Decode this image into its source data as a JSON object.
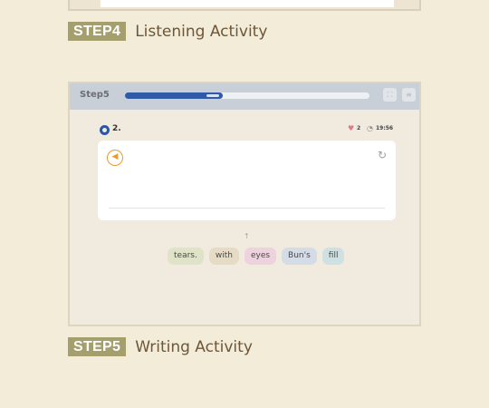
{
  "step4": {
    "badge": "STEP4",
    "title": "Listening Activity"
  },
  "activity": {
    "step_label": "Step5",
    "progress": 0.4,
    "question_number": "2.",
    "lives": "2",
    "timer": "19:56",
    "hint_arrow": "↑",
    "word_chips": [
      {
        "text": "tears.",
        "color": "#dfe3c8"
      },
      {
        "text": "with",
        "color": "#e6dcc6"
      },
      {
        "text": "eyes",
        "color": "#ecd3dd"
      },
      {
        "text": "Bun's",
        "color": "#d4dce6"
      },
      {
        "text": "fill",
        "color": "#cfe0e3"
      }
    ],
    "icons": {
      "question": "question-circle-icon",
      "lives": "heart-icon",
      "timer": "timer-icon",
      "audio": "speaker-icon",
      "refresh": "refresh-icon",
      "header_button_1": "expand-icon",
      "header_button_2": "menu-icon"
    }
  },
  "step5": {
    "badge": "STEP5",
    "title": "Writing Activity"
  },
  "colors": {
    "background": "#f2ecd9",
    "badge": "#a49f6d",
    "title_text": "#6e5638",
    "progress": "#2f5aa8",
    "audio_accent": "#ee9a2a"
  }
}
